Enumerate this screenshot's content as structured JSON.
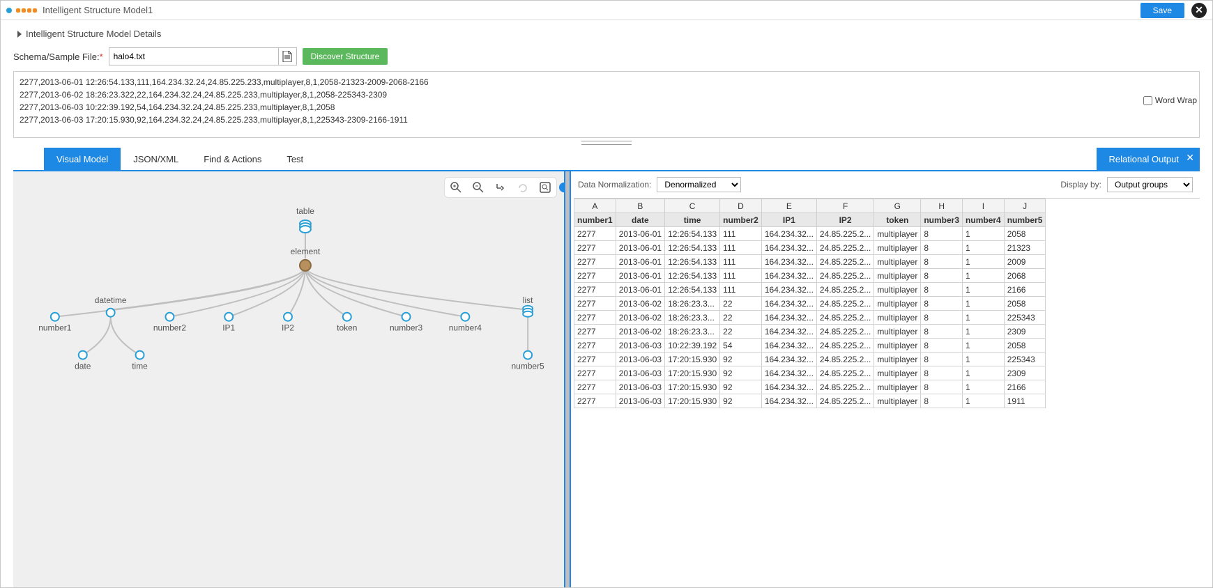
{
  "title": "Intelligent Structure Model1",
  "save_label": "Save",
  "details_header": "Intelligent Structure Model Details",
  "file_label": "Schema/Sample File:",
  "file_value": "halo4.txt",
  "discover_label": "Discover Structure",
  "wordwrap_label": "Word Wrap",
  "sample_lines": [
    "2277,2013-06-01 12:26:54.133,111,164.234.32.24,24.85.225.233,multiplayer,8,1,2058-21323-2009-2068-2166",
    "2277,2013-06-02 18:26:23.322,22,164.234.32.24,24.85.225.233,multiplayer,8,1,2058-225343-2309",
    "2277,2013-06-03 10:22:39.192,54,164.234.32.24,24.85.225.233,multiplayer,8,1,2058",
    "2277,2013-06-03 17:20:15.930,92,164.234.32.24,24.85.225.233,multiplayer,8,1,225343-2309-2166-1911"
  ],
  "tabs": {
    "visual": "Visual Model",
    "json": "JSON/XML",
    "find": "Find & Actions",
    "test": "Test",
    "relout": "Relational Output"
  },
  "graph_nodes": {
    "table": "table",
    "element": "element",
    "number1": "number1",
    "datetime": "datetime",
    "number2": "number2",
    "ip1": "IP1",
    "ip2": "IP2",
    "token": "token",
    "number3": "number3",
    "number4": "number4",
    "list": "list",
    "date": "date",
    "time": "time",
    "number5": "number5"
  },
  "right": {
    "norm_label": "Data Normalization:",
    "norm_value": "Denormalized",
    "display_label": "Display by:",
    "display_value": "Output groups"
  },
  "columns_letters": [
    "A",
    "B",
    "C",
    "D",
    "E",
    "F",
    "G",
    "H",
    "I",
    "J"
  ],
  "columns": [
    "number1",
    "date",
    "time",
    "number2",
    "IP1",
    "IP2",
    "token",
    "number3",
    "number4",
    "number5"
  ],
  "rows": [
    [
      "2277",
      "2013-06-01",
      "12:26:54.133",
      "111",
      "164.234.32...",
      "24.85.225.2...",
      "multiplayer",
      "8",
      "1",
      "2058"
    ],
    [
      "2277",
      "2013-06-01",
      "12:26:54.133",
      "111",
      "164.234.32...",
      "24.85.225.2...",
      "multiplayer",
      "8",
      "1",
      "21323"
    ],
    [
      "2277",
      "2013-06-01",
      "12:26:54.133",
      "111",
      "164.234.32...",
      "24.85.225.2...",
      "multiplayer",
      "8",
      "1",
      "2009"
    ],
    [
      "2277",
      "2013-06-01",
      "12:26:54.133",
      "111",
      "164.234.32...",
      "24.85.225.2...",
      "multiplayer",
      "8",
      "1",
      "2068"
    ],
    [
      "2277",
      "2013-06-01",
      "12:26:54.133",
      "111",
      "164.234.32...",
      "24.85.225.2...",
      "multiplayer",
      "8",
      "1",
      "2166"
    ],
    [
      "2277",
      "2013-06-02",
      "18:26:23.3...",
      "22",
      "164.234.32...",
      "24.85.225.2...",
      "multiplayer",
      "8",
      "1",
      "2058"
    ],
    [
      "2277",
      "2013-06-02",
      "18:26:23.3...",
      "22",
      "164.234.32...",
      "24.85.225.2...",
      "multiplayer",
      "8",
      "1",
      "225343"
    ],
    [
      "2277",
      "2013-06-02",
      "18:26:23.3...",
      "22",
      "164.234.32...",
      "24.85.225.2...",
      "multiplayer",
      "8",
      "1",
      "2309"
    ],
    [
      "2277",
      "2013-06-03",
      "10:22:39.192",
      "54",
      "164.234.32...",
      "24.85.225.2...",
      "multiplayer",
      "8",
      "1",
      "2058"
    ],
    [
      "2277",
      "2013-06-03",
      "17:20:15.930",
      "92",
      "164.234.32...",
      "24.85.225.2...",
      "multiplayer",
      "8",
      "1",
      "225343"
    ],
    [
      "2277",
      "2013-06-03",
      "17:20:15.930",
      "92",
      "164.234.32...",
      "24.85.225.2...",
      "multiplayer",
      "8",
      "1",
      "2309"
    ],
    [
      "2277",
      "2013-06-03",
      "17:20:15.930",
      "92",
      "164.234.32...",
      "24.85.225.2...",
      "multiplayer",
      "8",
      "1",
      "2166"
    ],
    [
      "2277",
      "2013-06-03",
      "17:20:15.930",
      "92",
      "164.234.32...",
      "24.85.225.2...",
      "multiplayer",
      "8",
      "1",
      "1911"
    ]
  ]
}
